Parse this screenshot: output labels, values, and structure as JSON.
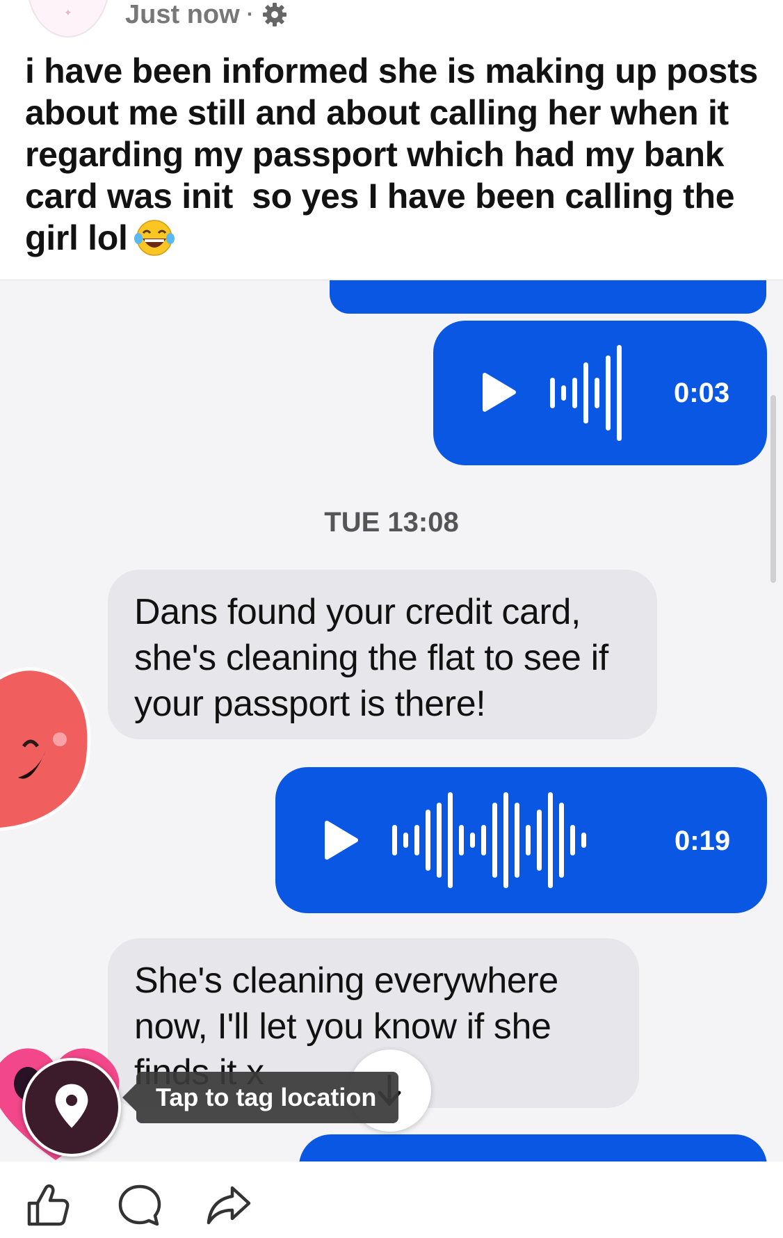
{
  "post": {
    "timestamp": "Just now",
    "separator": "·",
    "audience_icon": "gear-icon",
    "text": "i have been informed she is making up posts about me still and about calling her when it regarding my passport which had my bank card was init  so yes I have been calling the girl lol",
    "emoji": "laughing-tears-emoji"
  },
  "conversation": {
    "voice_message_1": {
      "duration": "0:03"
    },
    "date_separator": "TUE 13:08",
    "message_1": "Dans found your credit card, she's cleaning the flat to see if your passport is there!",
    "voice_message_2": {
      "duration": "0:19"
    },
    "message_2": "She's cleaning everywhere now, I'll let you know if she finds it x"
  },
  "overlay": {
    "location_tooltip": "Tap to tag location",
    "pin_icon": "location-pin-icon",
    "scroll_icon": "arrow-down-icon"
  },
  "actions": {
    "icons": [
      "like-icon",
      "comment-icon",
      "share-icon"
    ]
  },
  "colors": {
    "outgoing_bubble": "#0a57e4",
    "incoming_bubble": "#e7e6ea",
    "chat_background": "#f4f3f6"
  }
}
